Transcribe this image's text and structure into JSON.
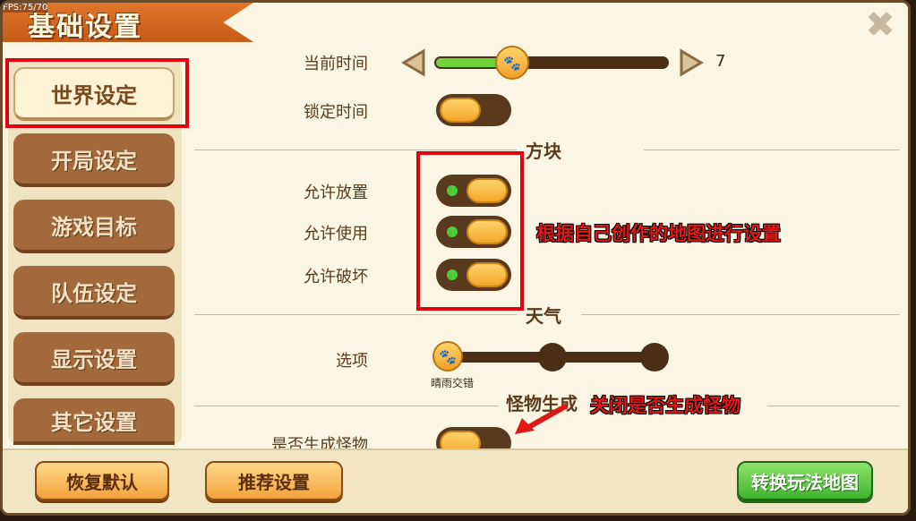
{
  "title": "基础设置",
  "fps": "FPS:75/70",
  "sidebar": {
    "items": [
      {
        "label": "世界设定",
        "active": true
      },
      {
        "label": "开局设定"
      },
      {
        "label": "游戏目标"
      },
      {
        "label": "队伍设定"
      },
      {
        "label": "显示设置"
      },
      {
        "label": "其它设置"
      }
    ]
  },
  "settings": {
    "current_time": {
      "label": "当前时间",
      "value": "7",
      "level": 0.22
    },
    "lock_time": {
      "label": "锁定时间",
      "on": false
    },
    "blocks_title": "方块",
    "allow_place": {
      "label": "允许放置",
      "on": true
    },
    "allow_use": {
      "label": "允许使用",
      "on": true
    },
    "allow_break": {
      "label": "允许破坏",
      "on": true
    },
    "weather_title": "天气",
    "weather_option": {
      "label": "选项",
      "selected": "晴雨交错"
    },
    "monster_title": "怪物生成",
    "spawn_monsters": {
      "label": "是否生成怪物",
      "on": false
    }
  },
  "annotations": {
    "blocks_note": "根据自己创作的地图进行设置",
    "monster_note": "关闭是否生成怪物"
  },
  "buttons": {
    "reset": "恢复默认",
    "recommended": "推荐设置",
    "switch_map": "转换玩法地图"
  },
  "colors": {
    "annotation": "#e01818",
    "accent": "#f4a62a",
    "toggle_track": "#5a3a1e",
    "active_green": "#4ecb3a"
  }
}
